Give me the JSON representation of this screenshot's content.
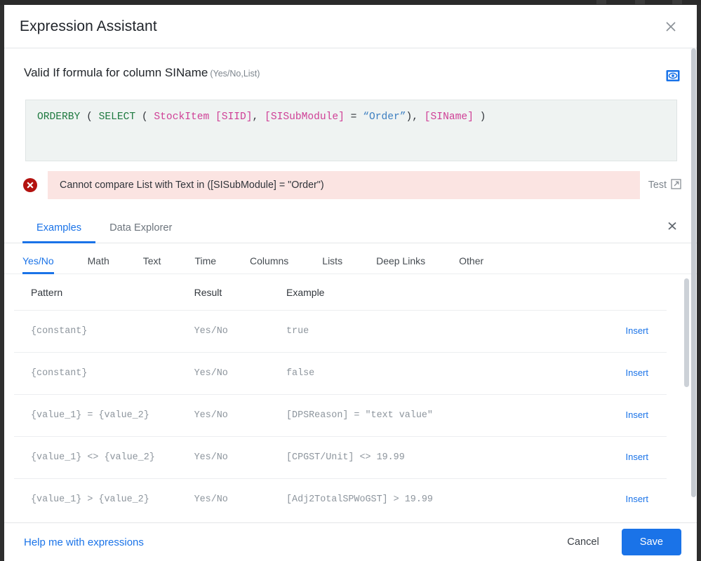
{
  "window": {
    "title": "Expression Assistant",
    "close_icon": "close-icon"
  },
  "formula": {
    "label": "Valid If formula for column SIName",
    "qualifier": "(Yes/No,List)",
    "preview_icon": "eye-icon",
    "expression": "ORDERBY ( SELECT ( StockItem [SIID], [SISubModule] = “Order”), [SIName] )",
    "tokens": [
      {
        "text": "ORDERBY",
        "type": "kw"
      },
      {
        "text": " ( ",
        "type": "op"
      },
      {
        "text": "SELECT",
        "type": "kw"
      },
      {
        "text": " ( ",
        "type": "op"
      },
      {
        "text": "StockItem [SIID]",
        "type": "id"
      },
      {
        "text": ", ",
        "type": "op"
      },
      {
        "text": "[SISubModule]",
        "type": "id"
      },
      {
        "text": " = ",
        "type": "op"
      },
      {
        "text": "“Order”",
        "type": "str"
      },
      {
        "text": "), ",
        "type": "op"
      },
      {
        "text": "[SIName]",
        "type": "id"
      },
      {
        "text": " )",
        "type": "op"
      }
    ]
  },
  "error": {
    "icon": "error-circle-icon",
    "message": "Cannot compare List with Text in ([SISubModule] = \"Order\")",
    "test_label": "Test",
    "test_icon": "external-link-icon",
    "background": "#fbe4e2",
    "icon_color": "#c5221f"
  },
  "main_tabs": {
    "collapse_icon": "collapse-icon",
    "items": [
      {
        "label": "Examples",
        "active": true
      },
      {
        "label": "Data Explorer",
        "active": false
      }
    ]
  },
  "sub_tabs": {
    "items": [
      {
        "label": "Yes/No",
        "active": true
      },
      {
        "label": "Math",
        "active": false
      },
      {
        "label": "Text",
        "active": false
      },
      {
        "label": "Time",
        "active": false
      },
      {
        "label": "Columns",
        "active": false
      },
      {
        "label": "Lists",
        "active": false
      },
      {
        "label": "Deep Links",
        "active": false
      },
      {
        "label": "Other",
        "active": false
      }
    ]
  },
  "examples_table": {
    "columns": [
      "Pattern",
      "Result",
      "Example",
      ""
    ],
    "action_label": "Insert",
    "rows": [
      {
        "pattern": "{constant}",
        "result": "Yes/No",
        "example": "true",
        "action": "Insert"
      },
      {
        "pattern": "{constant}",
        "result": "Yes/No",
        "example": "false",
        "action": "Insert"
      },
      {
        "pattern": "{value_1} = {value_2}",
        "result": "Yes/No",
        "example": "[DPSReason] = \"text value\"",
        "action": "Insert"
      },
      {
        "pattern": "{value_1} <> {value_2}",
        "result": "Yes/No",
        "example": "[CPGST/Unit] <> 19.99",
        "action": "Insert"
      },
      {
        "pattern": "{value_1} > {value_2}",
        "result": "Yes/No",
        "example": "[Adj2TotalSPWoGST] > 19.99",
        "action": "Insert"
      }
    ]
  },
  "footer": {
    "help_label": "Help me with expressions",
    "cancel_label": "Cancel",
    "save_label": "Save"
  },
  "colors": {
    "accent": "#1a73e8",
    "error_bg": "#fbe4e2",
    "error_icon": "#c5221f",
    "code_bg": "#eff3f2",
    "keyword": "#1f7a40",
    "identifier": "#cf3f96",
    "string": "#3d7fc1"
  }
}
